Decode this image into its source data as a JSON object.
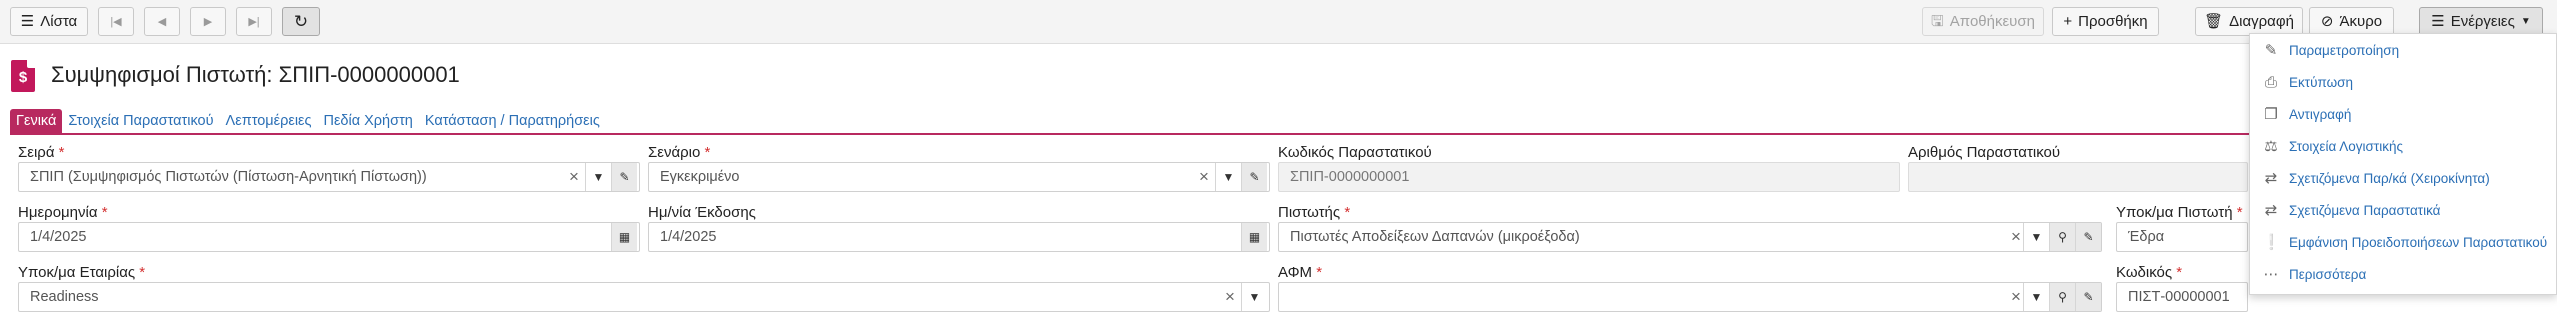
{
  "toolbar": {
    "list_label": "Λίστα",
    "save_label": "Αποθήκευση",
    "add_label": "Προσθήκη",
    "delete_label": "Διαγραφή",
    "cancel_label": "Άκυρο",
    "actions_label": "Ενέργειες"
  },
  "header": {
    "title": "Συμψηφισμοί Πιστωτή: ΣΠΙΠ-0000000001",
    "icon_glyph": "$"
  },
  "tabs": [
    "Γενικά",
    "Στοιχεία Παραστατικού",
    "Λεπτομέρειες",
    "Πεδία Χρήστη",
    "Κατάσταση / Παρατηρήσεις"
  ],
  "required_mark": "*",
  "form": {
    "series": {
      "label": "Σειρά",
      "value": "ΣΠΙΠ (Συμψηφισμός Πιστωτών (Πίστωση-Αρνητική Πίστωση))"
    },
    "scenario": {
      "label": "Σενάριο",
      "value": "Εγκεκριμένο"
    },
    "doc_code": {
      "label": "Κωδικός Παραστατικού",
      "value": "ΣΠΙΠ-0000000001"
    },
    "doc_number": {
      "label": "Αριθμός Παραστατικού",
      "value": ""
    },
    "date": {
      "label": "Ημερομηνία",
      "value": "1/4/2025"
    },
    "issue_date": {
      "label": "Ημ/νία Έκδοσης",
      "value": "1/4/2025"
    },
    "creditor": {
      "label": "Πιστωτής",
      "value": "Πιστωτές Αποδείξεων Δαπανών (μικροέξοδα)"
    },
    "creditor_branch": {
      "label": "Υποκ/μα Πιστωτή",
      "value": "Έδρα"
    },
    "company_branch": {
      "label": "Υποκ/μα Εταιρίας",
      "value": "Readiness"
    },
    "vat": {
      "label": "ΑΦΜ",
      "value": ""
    },
    "code": {
      "label": "Κωδικός",
      "value": "ΠΙΣΤ-00000001"
    }
  },
  "actions_menu": [
    {
      "label": "Παραμετροποίηση",
      "icon": "edit-icon"
    },
    {
      "label": "Εκτύπωση",
      "icon": "print-icon"
    },
    {
      "label": "Αντιγραφή",
      "icon": "copy-icon"
    },
    {
      "label": "Στοιχεία Λογιστικής",
      "icon": "balance-icon"
    },
    {
      "label": "Σχετιζόμενα Παρ/κά (Χειροκίνητα)",
      "icon": "swap-icon"
    },
    {
      "label": "Σχετιζόμενα Παραστατικά",
      "icon": "swap-icon"
    },
    {
      "label": "Εμφάνιση Προειδοποιήσεων Παραστατικού",
      "icon": "warning-icon"
    },
    {
      "label": "Περισσότερα",
      "icon": "more-icon"
    }
  ],
  "colors": {
    "accent": "#b8295f",
    "link": "#2b6fb5",
    "required": "#d32f2f"
  }
}
